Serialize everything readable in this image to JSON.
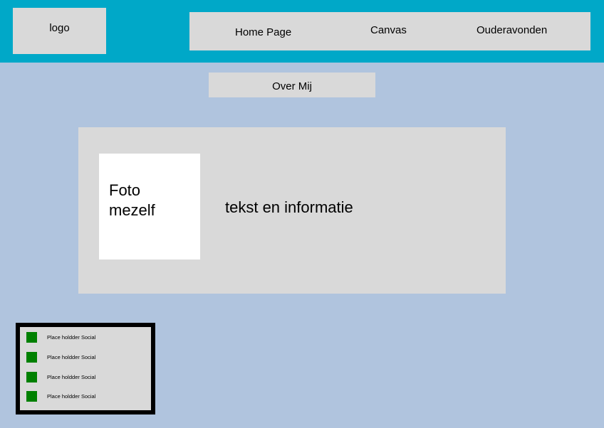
{
  "header": {
    "logo_text": "logo",
    "nav": {
      "home": "Home Page",
      "canvas": "Canvas",
      "ouderavonden": "Ouderavonden"
    }
  },
  "subnav": {
    "over_mij": "Over Mij"
  },
  "main": {
    "photo_label": "Foto mezelf",
    "info_text": "tekst en informatie"
  },
  "social": {
    "items": [
      {
        "label": "Place holdder Social",
        "icon": "social-placeholder-icon",
        "color": "#008000"
      },
      {
        "label": "Place holdder Social",
        "icon": "social-placeholder-icon",
        "color": "#008000"
      },
      {
        "label": "Place holdder Social",
        "icon": "social-placeholder-icon",
        "color": "#008000"
      },
      {
        "label": "Place holdder Social",
        "icon": "social-placeholder-icon",
        "color": "#008000"
      }
    ]
  },
  "colors": {
    "header_bg": "#00a8c8",
    "page_bg": "#b0c4de",
    "panel_bg": "#d9d9d9"
  }
}
